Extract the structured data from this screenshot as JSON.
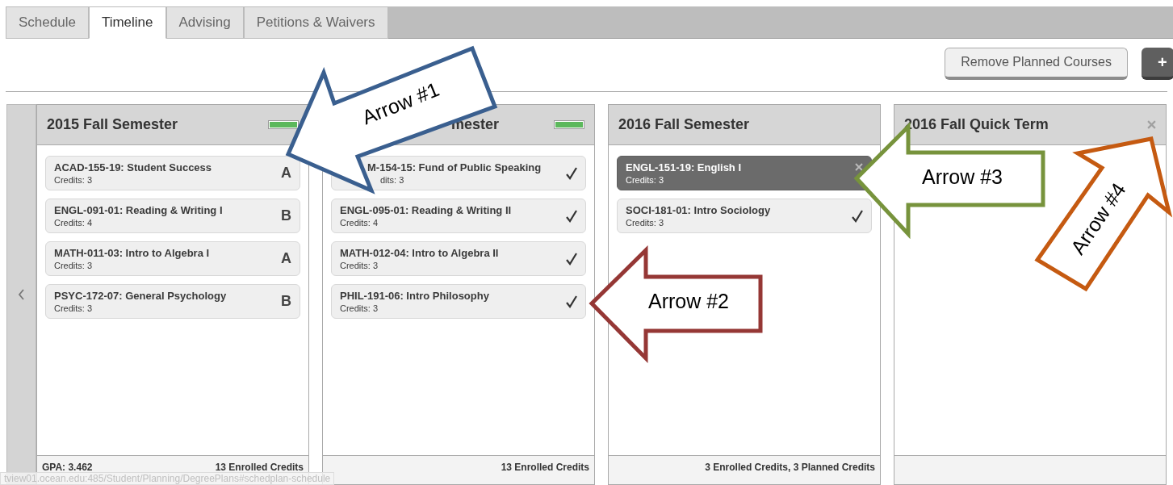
{
  "tabs": [
    {
      "label": "Schedule",
      "selected": false
    },
    {
      "label": "Timeline",
      "selected": true
    },
    {
      "label": "Advising",
      "selected": false
    },
    {
      "label": "Petitions & Waivers",
      "selected": false
    }
  ],
  "toolbar": {
    "buttons": [
      {
        "label": "Remove Planned Courses",
        "kind": "light"
      },
      {
        "label": "+",
        "kind": "dark"
      }
    ]
  },
  "terms": [
    {
      "title": "2015 Fall Semester",
      "level": 1,
      "removable": false,
      "courses": [
        {
          "title": "ACAD-155-19: Student Success",
          "credits": "Credits: 3",
          "kind": "grade",
          "grade": "A",
          "selected": false
        },
        {
          "title": "ENGL-091-01: Reading & Writing I",
          "credits": "Credits: 4",
          "kind": "grade",
          "grade": "B",
          "selected": false
        },
        {
          "title": "MATH-011-03: Intro to Algebra I",
          "credits": "Credits: 3",
          "kind": "grade",
          "grade": "A",
          "selected": false
        },
        {
          "title": "PSYC-172-07: General Psychology",
          "credits": "Credits: 3",
          "kind": "grade",
          "grade": "B",
          "selected": false
        }
      ],
      "footer_left": "GPA: 3.462",
      "footer_right": "13 Enrolled Credits"
    },
    {
      "title": "mester",
      "level": 1,
      "removable": false,
      "courses": [
        {
          "title": "M-154-15: Fund of Public Speaking",
          "credits": "dits: 3",
          "kind": "check",
          "selected": false
        },
        {
          "title": "ENGL-095-01: Reading & Writing II",
          "credits": "Credits: 4",
          "kind": "check",
          "selected": false
        },
        {
          "title": "MATH-012-04: Intro to Algebra II",
          "credits": "Credits: 3",
          "kind": "check",
          "selected": false
        },
        {
          "title": "PHIL-191-06: Intro Philosophy",
          "credits": "Credits: 3",
          "kind": "check",
          "selected": false
        }
      ],
      "footer_right": "13 Enrolled Credits"
    },
    {
      "title": "2016 Fall Semester",
      "removable": false,
      "courses": [
        {
          "title": "ENGL-151-19: English I",
          "credits": "Credits: 3",
          "kind": "remove",
          "selected": true
        },
        {
          "title": "SOCI-181-01: Intro Sociology",
          "credits": "Credits: 3",
          "kind": "check",
          "selected": false
        }
      ],
      "footer_right": "3 Enrolled Credits, 3 Planned Credits"
    },
    {
      "title": "2016 Fall Quick Term",
      "removable": true
    }
  ],
  "annotations": [
    {
      "label": "Arrow #1",
      "color": "#3a5f8f"
    },
    {
      "label": "Arrow #2",
      "color": "#953735"
    },
    {
      "label": "Arrow #3",
      "color": "#77933c"
    },
    {
      "label": "Arrow #4",
      "color": "#c55a11"
    }
  ],
  "status_url": "tview01.ocean.edu:485/Student/Planning/DegreePlans#schedplan-schedule"
}
